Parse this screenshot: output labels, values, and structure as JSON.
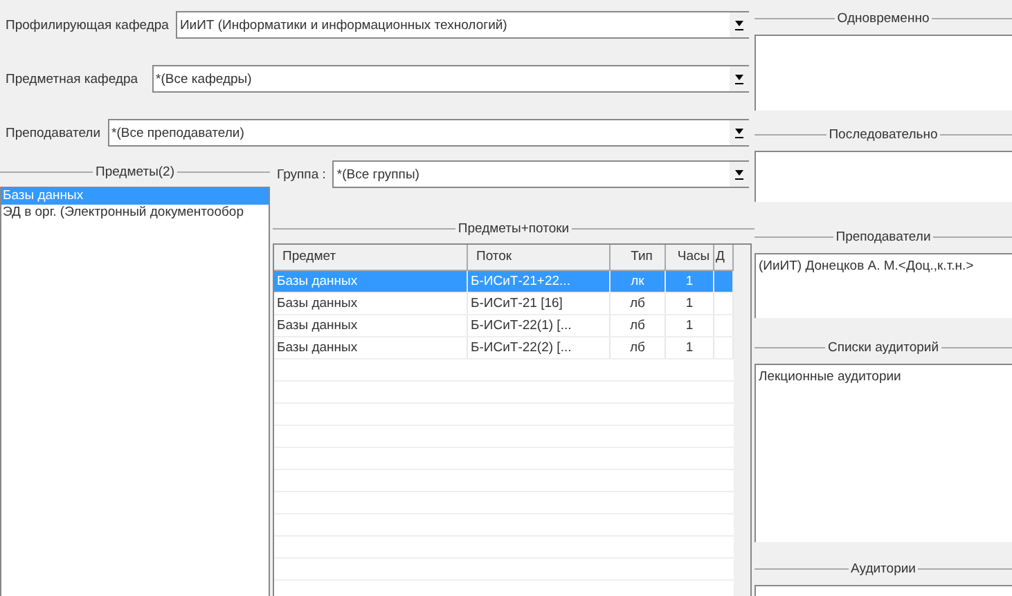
{
  "filters": [
    {
      "label": "Профилирующая кафедра",
      "value": "ИиИТ (Информатики и информационных технологий)"
    },
    {
      "label": "Предметная кафедра",
      "value": "*(Все кафедры)"
    },
    {
      "label": "Преподаватели",
      "value": "*(Все преподаватели)"
    }
  ],
  "subjects": {
    "title": "Предметы(2)",
    "items": [
      {
        "label": "Базы данных",
        "selected": true
      },
      {
        "label": "ЭД в орг. (Электронный документообор",
        "selected": false
      }
    ]
  },
  "group": {
    "label": "Группа :",
    "value": "*(Все группы)"
  },
  "streams": {
    "title": "Предметы+потоки",
    "columns": [
      "Предмет",
      "Поток",
      "Тип",
      "Часы",
      "Д"
    ],
    "rows": [
      {
        "cells": [
          "Базы данных",
          "Б-ИСиТ-21+22...",
          "лк",
          "1",
          ""
        ],
        "selected": true
      },
      {
        "cells": [
          "Базы данных",
          "Б-ИСиТ-21 [16]",
          "лб",
          "1",
          ""
        ],
        "selected": false
      },
      {
        "cells": [
          "Базы данных",
          "Б-ИСиТ-22(1) [...",
          "лб",
          "1",
          ""
        ],
        "selected": false
      },
      {
        "cells": [
          "Базы данных",
          "Б-ИСиТ-22(2) [...",
          "лб",
          "1",
          ""
        ],
        "selected": false
      }
    ]
  },
  "right_panels": [
    {
      "title": "Одновременно"
    },
    {
      "title": "Последовательно"
    },
    {
      "title": "Преподаватели",
      "items": [
        "(ИиИТ) Донецков А. М.<Доц.,к.т.н.>"
      ]
    },
    {
      "title": "Списки аудиторий",
      "items": [
        "Лекционные аудитории"
      ]
    },
    {
      "title": "Аудитории"
    }
  ]
}
